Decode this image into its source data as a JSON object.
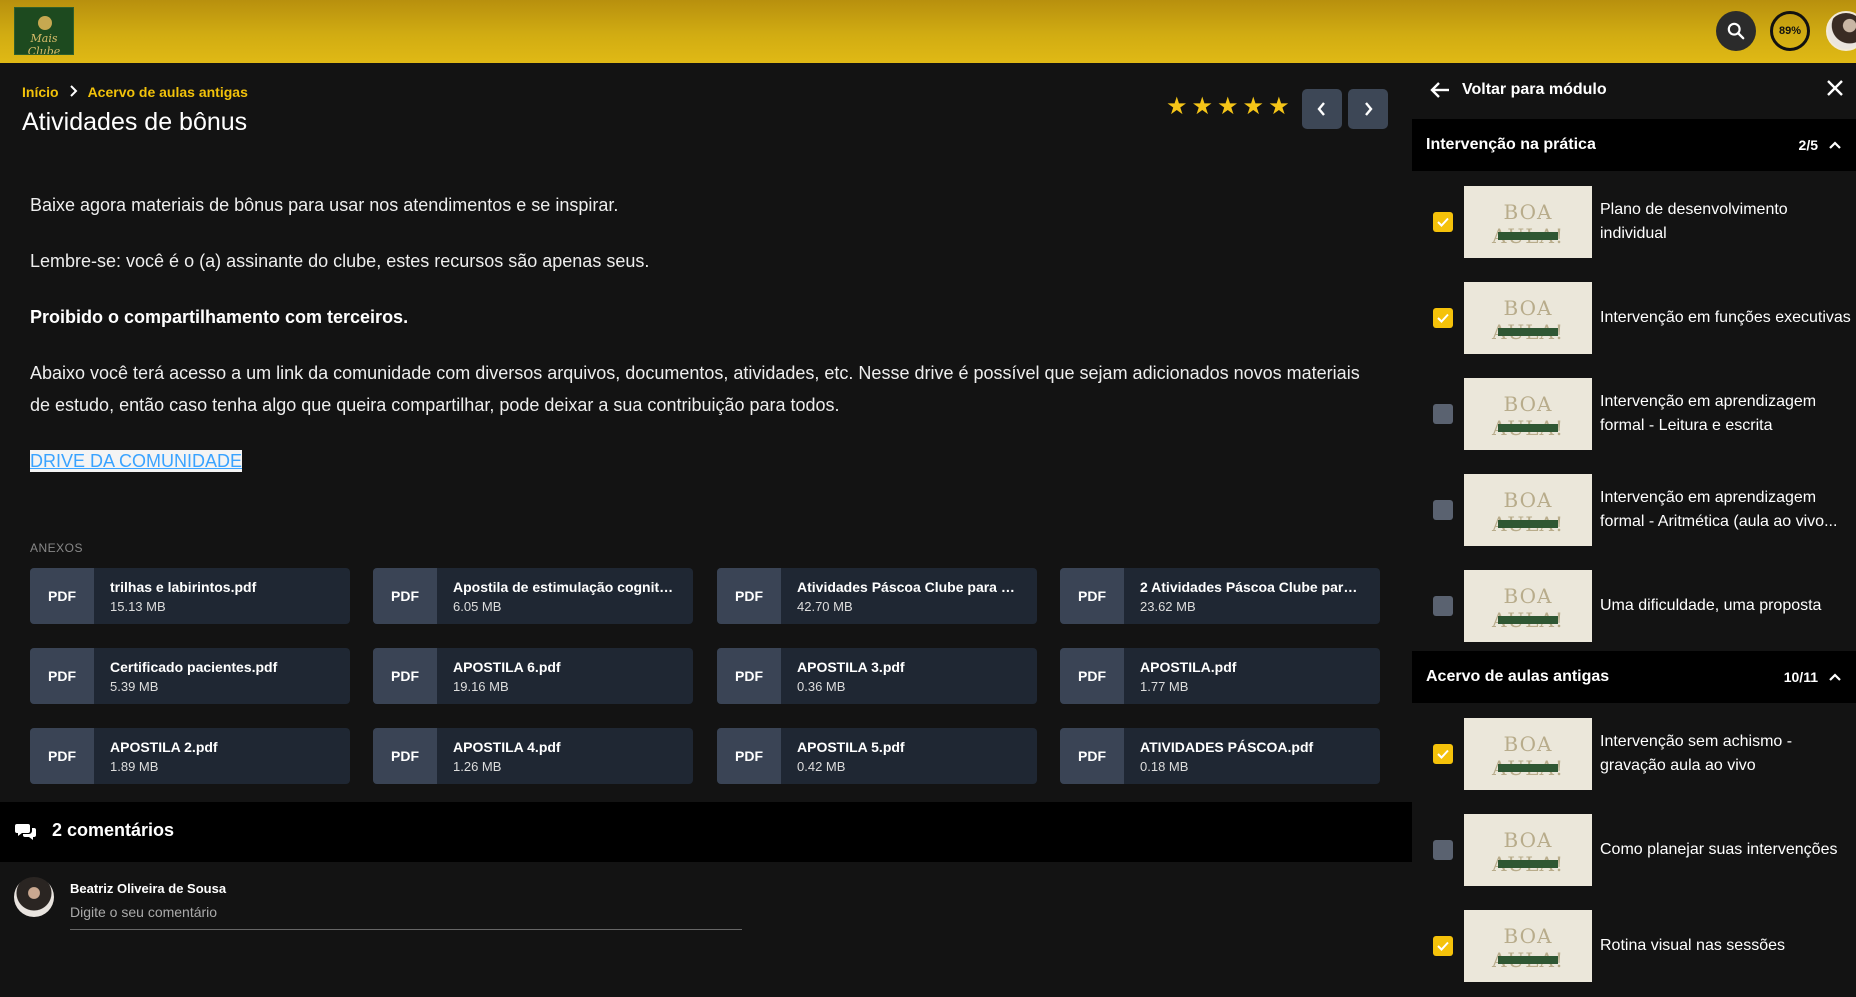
{
  "header": {
    "logo_text": "Mais Clube",
    "progress": "89%",
    "colors": {
      "bar": "#d1ac12",
      "accent": "#f5c20a"
    }
  },
  "breadcrumb": {
    "home": "Início",
    "current": "Acervo de aulas antigas"
  },
  "page": {
    "title": "Atividades de bônus",
    "rating": 5,
    "paragraphs": [
      "Baixe agora materiais de bônus para usar nos atendimentos e se inspirar.",
      "Lembre-se: você é o (a) assinante do clube, estes recursos são apenas seus.",
      "Proibido o compartilhamento com terceiros.",
      "Abaixo você terá acesso a um link da comunidade com diversos arquivos, documentos, atividades, etc. Nesse drive é possível que sejam adicionados novos materiais de estudo, então caso tenha algo que queira compartilhar, pode deixar a sua contribuição para todos."
    ],
    "drive_link": "DRIVE DA COMUNIDADE"
  },
  "attachments": {
    "label": "ANEXOS",
    "tag": "PDF",
    "files": [
      {
        "name": "trilhas e labirintos.pdf",
        "size": "15.13 MB"
      },
      {
        "name": "Apostila de estimulação cognitiv...",
        "size": "6.05 MB"
      },
      {
        "name": "Atividades Páscoa Clube para psi...",
        "size": "42.70 MB"
      },
      {
        "name": "2 Atividades Páscoa Clube para ...",
        "size": "23.62 MB"
      },
      {
        "name": "Certificado pacientes.pdf",
        "size": "5.39 MB"
      },
      {
        "name": "APOSTILA 6.pdf",
        "size": "19.16 MB"
      },
      {
        "name": "APOSTILA 3.pdf",
        "size": "0.36 MB"
      },
      {
        "name": "APOSTILA.pdf",
        "size": "1.77 MB"
      },
      {
        "name": "APOSTILA 2.pdf",
        "size": "1.89 MB"
      },
      {
        "name": "APOSTILA 4.pdf",
        "size": "1.26 MB"
      },
      {
        "name": "APOSTILA 5.pdf",
        "size": "0.42 MB"
      },
      {
        "name": "ATIVIDADES PÁSCOA.pdf",
        "size": "0.18 MB"
      }
    ]
  },
  "comments": {
    "title": "2 comentários",
    "user_name": "Beatriz Oliveira de Sousa",
    "placeholder": "Digite o seu comentário"
  },
  "sidebar": {
    "back_label": "Voltar para módulo",
    "thumb_text": "BOA AULA!",
    "sections": [
      {
        "title": "Intervenção na prática",
        "count": "2/5",
        "lessons": [
          {
            "title": "Plano de desenvolvimento individual",
            "done": true
          },
          {
            "title": "Intervenção em funções executivas",
            "done": true
          },
          {
            "title": "Intervenção em aprendizagem formal - Leitura e escrita",
            "done": false
          },
          {
            "title": "Intervenção em aprendizagem formal - Aritmética (aula ao vivo...",
            "done": false
          },
          {
            "title": "Uma dificuldade, uma proposta",
            "done": false
          }
        ]
      },
      {
        "title": "Acervo de aulas antigas",
        "count": "10/11",
        "lessons": [
          {
            "title": "Intervenção sem achismo - gravação aula ao vivo",
            "done": true
          },
          {
            "title": "Como planejar suas intervenções",
            "done": false
          },
          {
            "title": "Rotina visual nas sessões",
            "done": true
          }
        ]
      }
    ]
  }
}
